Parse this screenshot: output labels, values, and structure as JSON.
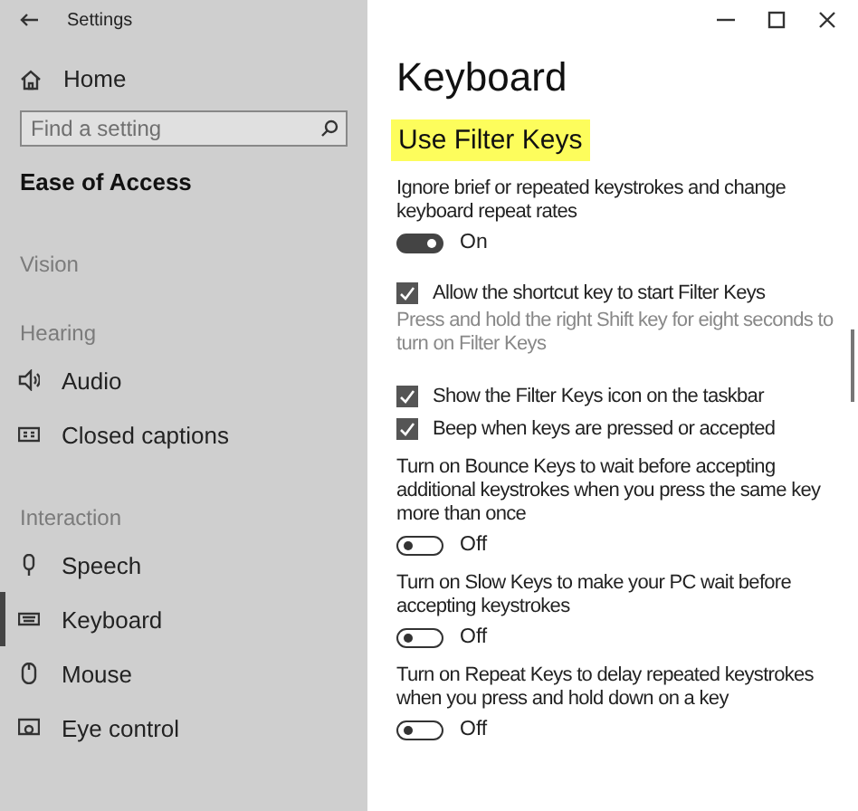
{
  "window": {
    "title": "Settings"
  },
  "sidebar": {
    "home": "Home",
    "search": {
      "placeholder": "Find a setting"
    },
    "section": "Ease of Access",
    "items": [
      {
        "kind": "group",
        "label": "Vision"
      },
      {
        "kind": "group",
        "label": "Hearing"
      },
      {
        "kind": "item",
        "label": "Audio",
        "selected": false
      },
      {
        "kind": "item",
        "label": "Closed captions",
        "selected": false
      },
      {
        "kind": "group",
        "label": "Interaction"
      },
      {
        "kind": "item",
        "label": "Speech",
        "selected": false
      },
      {
        "kind": "item",
        "label": "Keyboard",
        "selected": true
      },
      {
        "kind": "item",
        "label": "Mouse",
        "selected": false
      },
      {
        "kind": "item",
        "label": "Eye control",
        "selected": false
      }
    ]
  },
  "page": {
    "title": "Keyboard",
    "section": "Use Filter Keys",
    "content": [
      {
        "kind": "text",
        "text": "Ignore brief or repeated keystrokes and change keyboard repeat rates"
      },
      {
        "kind": "toggle",
        "on": true,
        "label": "On"
      },
      {
        "kind": "checkbox",
        "checked": true,
        "label": "Allow the shortcut key to start Filter Keys"
      },
      {
        "kind": "hint",
        "text": "Press and hold the right Shift key for eight seconds to turn on Filter Keys"
      },
      {
        "kind": "checkbox",
        "checked": true,
        "label": "Show the Filter Keys icon on the taskbar"
      },
      {
        "kind": "checkbox",
        "checked": true,
        "label": "Beep when keys are pressed or accepted"
      },
      {
        "kind": "text",
        "text": "Turn on Bounce Keys to wait before accepting additional keystrokes when you press the same key more than once"
      },
      {
        "kind": "toggle",
        "on": false,
        "label": "Off"
      },
      {
        "kind": "text",
        "text": "Turn on Slow Keys to make your PC wait before accepting keystrokes"
      },
      {
        "kind": "toggle",
        "on": false,
        "label": "Off"
      },
      {
        "kind": "text",
        "text": "Turn on Repeat Keys to delay repeated keystrokes when you press and hold down on a key"
      },
      {
        "kind": "toggle",
        "on": false,
        "label": "Off"
      }
    ]
  }
}
